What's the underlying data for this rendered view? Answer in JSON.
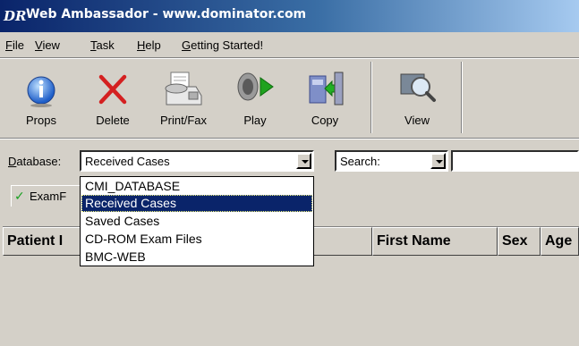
{
  "window": {
    "logo": "DR",
    "title": "Web Ambassador - www.dominator.com"
  },
  "menu": [
    {
      "label": "File",
      "key": "F",
      "rest": "ile"
    },
    {
      "label": "View",
      "key": "V",
      "rest": "iew"
    },
    {
      "label": "Task",
      "key": "T",
      "rest": "ask"
    },
    {
      "label": "Help",
      "key": "H",
      "rest": "elp"
    },
    {
      "label": "Getting Started!",
      "key": "G",
      "rest": "etting Started!"
    }
  ],
  "toolbar": {
    "props": {
      "label": "Props",
      "icon": "info-icon"
    },
    "delete": {
      "label": "Delete",
      "icon": "red-x-icon"
    },
    "printfax": {
      "label": "Print/Fax",
      "icon": "fax-machine-icon"
    },
    "play": {
      "label": "Play",
      "icon": "speaker-play-icon"
    },
    "copy": {
      "label": "Copy",
      "icon": "copy-to-disk-icon"
    },
    "view": {
      "label": "View",
      "icon": "magnifier-icon"
    }
  },
  "filter": {
    "database_label": "Database:",
    "database_key": "D",
    "database_rest": "atabase:",
    "database_value": "Received Cases",
    "search_value": "Search:",
    "search_text": ""
  },
  "dropdown": {
    "options": [
      "CMI_DATABASE",
      "Received Cases",
      "Saved Cases",
      "CD-ROM Exam Files",
      "BMC-WEB"
    ],
    "selected": "Received Cases"
  },
  "tabs": [
    {
      "label": "ExamF",
      "icon": "check-icon"
    }
  ],
  "table": {
    "columns": [
      "Patient I",
      "First Name",
      "Sex",
      "Age"
    ]
  },
  "colors": {
    "title_gradient_start": "#0a246a",
    "title_gradient_end": "#a6caf0",
    "selection": "#0a246a",
    "check": "#18a020",
    "delete_red": "#d42020",
    "face": "#d4d0c8"
  }
}
